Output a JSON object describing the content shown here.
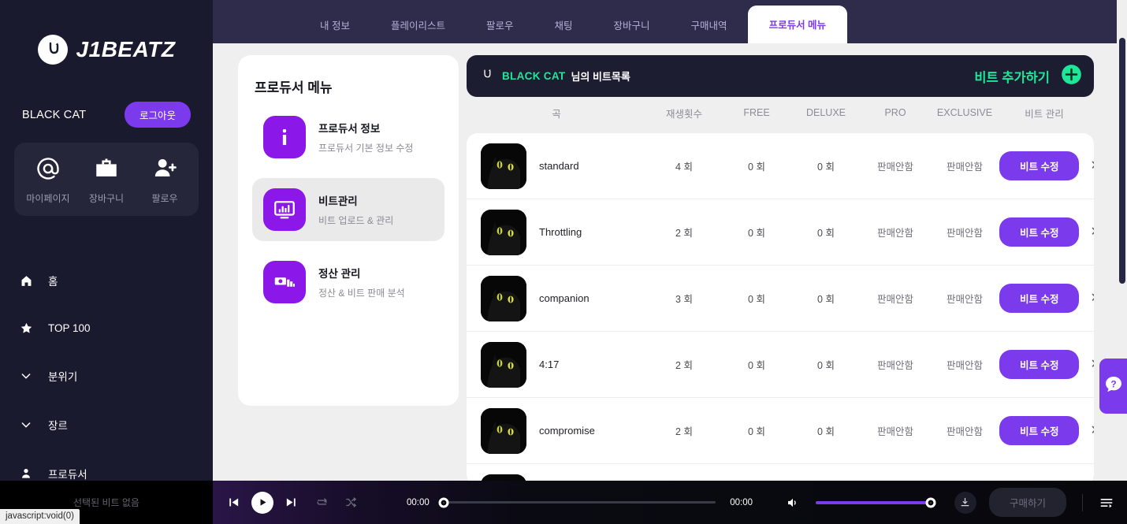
{
  "brand": {
    "name": "J1BEATZ",
    "logo_icon": "cat-logo-icon"
  },
  "sidebar": {
    "user_name": "BLACK CAT",
    "logout_label": "로그아웃",
    "quick_actions": [
      {
        "label": "마이페이지",
        "icon": "at-icon"
      },
      {
        "label": "장바구니",
        "icon": "shopping-bag-icon"
      },
      {
        "label": "팔로우",
        "icon": "person-add-icon"
      }
    ],
    "nav_items": [
      {
        "label": "홈",
        "icon": "home-icon"
      },
      {
        "label": "TOP 100",
        "icon": "star-icon"
      },
      {
        "label": "분위기",
        "icon": "chevron-down-icon"
      },
      {
        "label": "장르",
        "icon": "chevron-down-icon"
      },
      {
        "label": "프로듀서",
        "icon": "person-icon"
      }
    ]
  },
  "topbar": {
    "tabs": [
      {
        "label": "내 정보",
        "active": false
      },
      {
        "label": "플레이리스트",
        "active": false
      },
      {
        "label": "팔로우",
        "active": false
      },
      {
        "label": "채팅",
        "active": false
      },
      {
        "label": "장바구니",
        "active": false
      },
      {
        "label": "구매내역",
        "active": false
      },
      {
        "label": "프로듀서 메뉴",
        "active": true
      }
    ]
  },
  "producer_menu": {
    "title": "프로듀서 메뉴",
    "items": [
      {
        "title": "프로듀서 정보",
        "subtitle": "프로듀서 기본 정보 수정",
        "icon": "info-icon",
        "selected": false
      },
      {
        "title": "비트관리",
        "subtitle": "비트 업로드 & 관리",
        "icon": "monitor-chart-icon",
        "selected": true
      },
      {
        "title": "정산 관리",
        "subtitle": "정산 & 비트 판매 분석",
        "icon": "money-icon",
        "selected": false
      }
    ]
  },
  "beats_panel": {
    "owner_name": "BLACK CAT",
    "owner_suffix": "님의 비트목록",
    "owner_icon": "cat-logo-icon",
    "add_beat_label": "비트 추가하기",
    "add_beat_icon": "plus-circle-icon",
    "columns": [
      "곡",
      "재생횟수",
      "FREE",
      "DELUXE",
      "PRO",
      "EXCLUSIVE",
      "비트 관리"
    ],
    "edit_label": "비트 수정",
    "delete_icon": "close-icon",
    "rows": [
      {
        "song": "standard",
        "plays": "4 회",
        "free": "0 회",
        "deluxe": "0 회",
        "pro": "판매안함",
        "exclusive": "판매안함"
      },
      {
        "song": "Throttling",
        "plays": "2 회",
        "free": "0 회",
        "deluxe": "0 회",
        "pro": "판매안함",
        "exclusive": "판매안함"
      },
      {
        "song": "companion",
        "plays": "3 회",
        "free": "0 회",
        "deluxe": "0 회",
        "pro": "판매안함",
        "exclusive": "판매안함"
      },
      {
        "song": "4:17",
        "plays": "2 회",
        "free": "0 회",
        "deluxe": "0 회",
        "pro": "판매안함",
        "exclusive": "판매안함"
      },
      {
        "song": "compromise",
        "plays": "2 회",
        "free": "0 회",
        "deluxe": "0 회",
        "pro": "판매안함",
        "exclusive": "판매안함"
      }
    ]
  },
  "player": {
    "no_beat_label": "선택된 비트 없음",
    "current_time": "00:00",
    "total_time": "00:00",
    "progress_percent": 0,
    "volume_percent": 100,
    "buy_label": "구매하기",
    "icons": {
      "previous": "skip-previous-icon",
      "play": "play-icon",
      "next": "skip-next-icon",
      "repeat": "repeat-icon",
      "shuffle": "shuffle-icon",
      "volume": "volume-icon",
      "download": "download-icon",
      "queue": "playlist-queue-icon"
    }
  },
  "help": {
    "icon": "question-bubble-icon"
  },
  "browser_status": "javascript:void(0)",
  "colors": {
    "sidebar_bg": "#191a2e",
    "topbar_bg": "#2f2b4a",
    "accent_purple": "#7c3aed",
    "icon_purple": "#8b17e8",
    "accent_green": "#1ee79a",
    "panel_dark": "#1c1d31",
    "page_bg": "#efefef"
  }
}
